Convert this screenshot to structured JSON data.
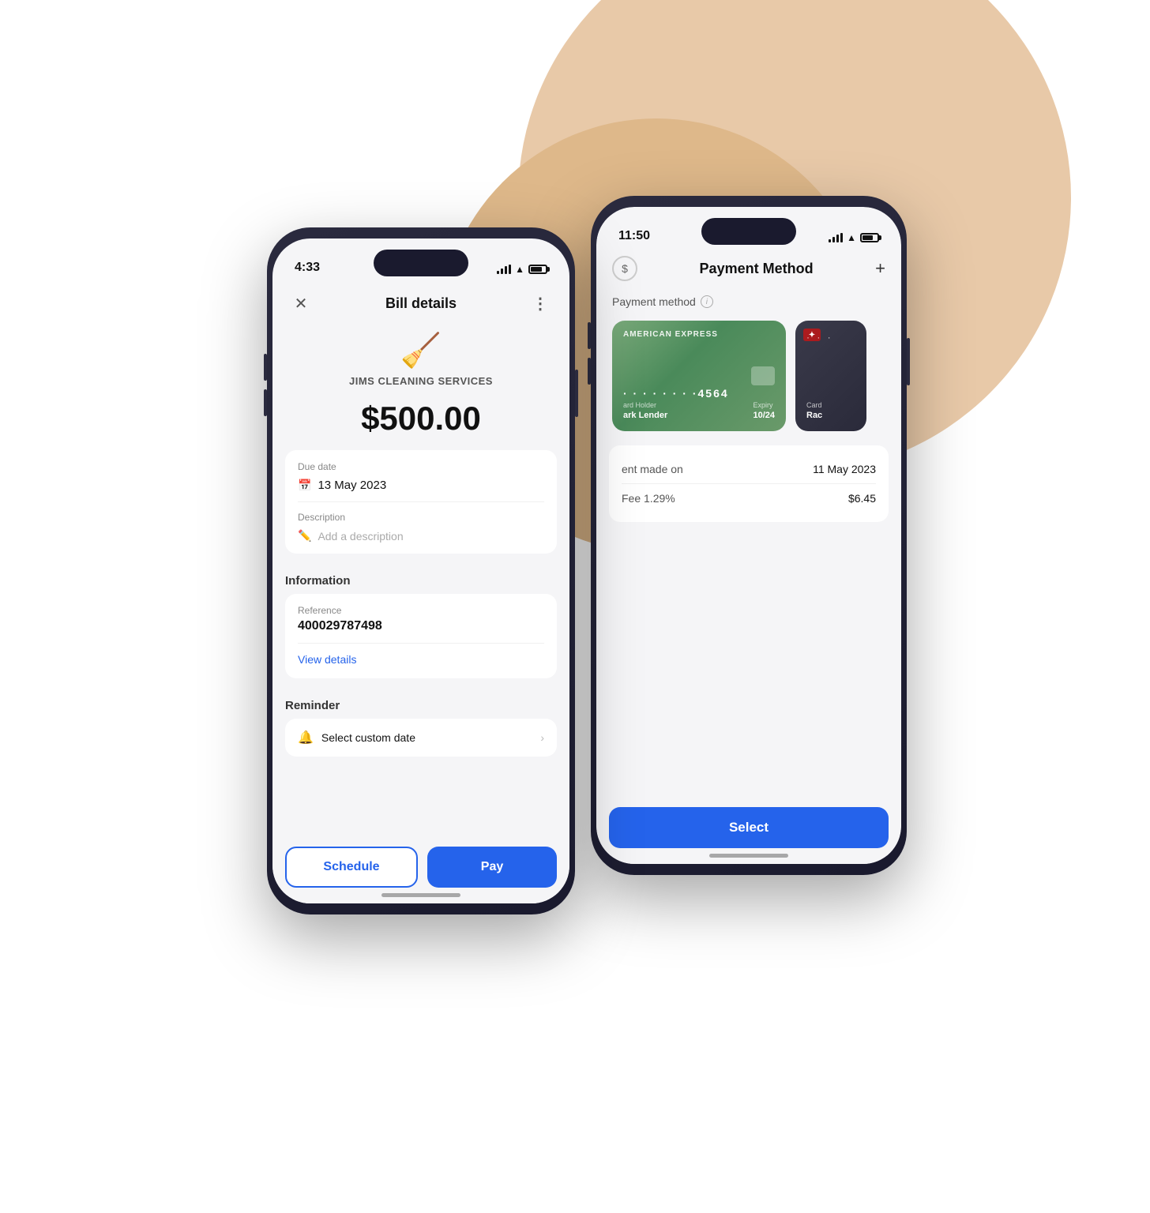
{
  "background": {
    "circle1_color": "#e8c9a8",
    "circle2_color": "#deb88a"
  },
  "phone_front": {
    "status_time": "4:33",
    "screen_title": "Bill details",
    "merchant_name": "JIMS CLEANING SERVICES",
    "amount": "$500.00",
    "due_date_label": "Due date",
    "due_date_value": "13 May 2023",
    "description_label": "Description",
    "description_placeholder": "Add a description",
    "info_section_label": "Information",
    "reference_label": "Reference",
    "reference_value": "400029787498",
    "view_details_text": "View details",
    "reminder_label": "Reminder",
    "reminder_placeholder": "Select custom date",
    "btn_schedule": "Schedule",
    "btn_pay": "Pay"
  },
  "phone_back": {
    "status_time": "11:50",
    "screen_title": "Payment Method",
    "payment_method_label": "Payment method",
    "add_icon": "+",
    "card1_network": "AMERICAN EXPRESS",
    "card1_number": "· · · · · · · ·4564",
    "card1_holder_label": "ard Holder",
    "card1_holder_name": "ark Lender",
    "card1_expiry_label": "Expiry",
    "card1_expiry": "10/24",
    "card2_dots": "· · ·",
    "card2_label": "Card",
    "card2_name": "Rac",
    "payment_made_label": "ent made on",
    "payment_made_date": "11 May 2023",
    "fee_label": "Fee 1.29%",
    "fee_value": "$6.45",
    "btn_select": "Select"
  }
}
